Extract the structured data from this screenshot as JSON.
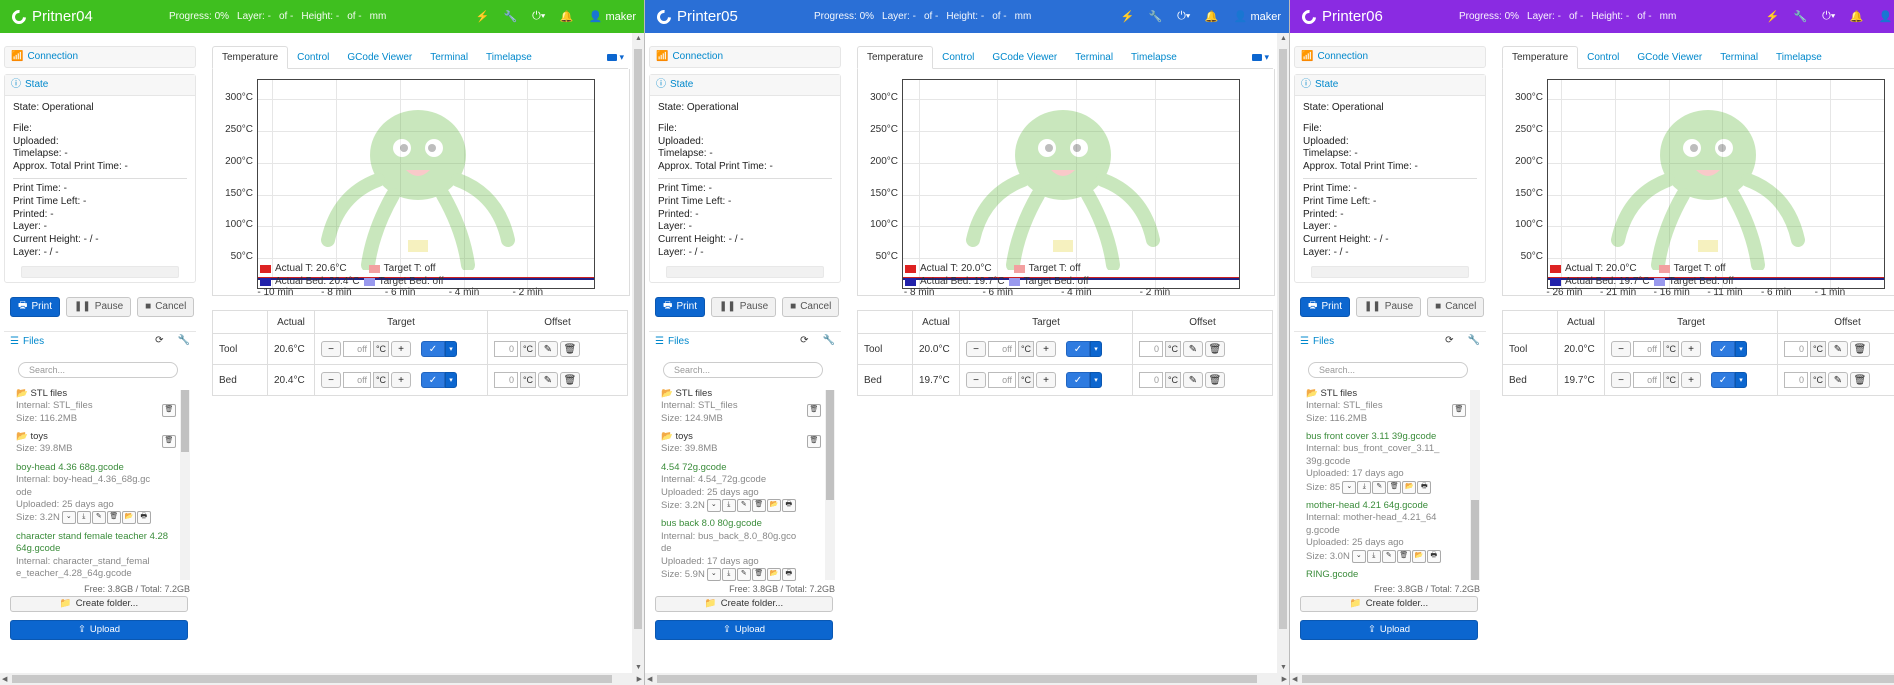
{
  "common": {
    "nav_progress": {
      "progress": "Progress: 0%",
      "layer": "Layer: -",
      "of1": "of -",
      "height": "Height: -",
      "of2": "of -",
      "mm": "mm"
    },
    "user_label": "maker",
    "sidebar": {
      "connection": "Connection",
      "state_title": "State",
      "state_line": "State: Operational",
      "file": "File:",
      "uploaded": "Uploaded:",
      "timelapse": "Timelapse: -",
      "approx": "Approx. Total Print Time: -",
      "print_time": "Print Time: -",
      "print_time_left": "Print Time Left: -",
      "printed": "Printed: -",
      "layer": "Layer: -",
      "current_height": "Current Height: - / -",
      "layer2": "Layer: - / -",
      "print_btn": "Print",
      "pause_btn": "Pause",
      "cancel_btn": "Cancel",
      "files": "Files",
      "search_placeholder": "Search...",
      "free": "Free: 3.8GB / Total: 7.2GB",
      "create_folder": "Create folder...",
      "upload": "Upload"
    },
    "tabs": [
      "Temperature",
      "Control",
      "GCode Viewer",
      "Terminal",
      "Timelapse"
    ],
    "table": {
      "headers": [
        "",
        "Actual",
        "Target",
        "Offset"
      ],
      "tool": "Tool",
      "bed": "Bed",
      "off_placeholder": "off",
      "unit": "°C",
      "zero": "0"
    },
    "y_ticks": [
      "300°C",
      "250°C",
      "200°C",
      "150°C",
      "100°C",
      "50°C"
    ]
  },
  "printers": [
    {
      "name": "Pritner04",
      "color": "#3fbf1f",
      "legend": {
        "actual_t": "Actual T: 20.6°C",
        "target_t": "Target T: off",
        "actual_bed": "Actual Bed: 20.4°C",
        "target_bed": "Target Bed: off"
      },
      "x_ticks": [
        "- 10 min",
        "- 8 min",
        "- 6 min",
        "- 4 min",
        "- 2 min"
      ],
      "tool_actual": "20.6°C",
      "bed_actual": "20.4°C",
      "files": [
        {
          "type": "folder",
          "name": "STL files",
          "lines": [
            "Internal: STL_files",
            "Size: 116.2MB"
          ]
        },
        {
          "type": "folder",
          "name": "toys",
          "lines": [
            "Size: 39.8MB"
          ]
        },
        {
          "type": "file",
          "name": "boy-head 4.36 68g.gcode",
          "lines": [
            "Internal: boy-head_4.36_68g.gc",
            "ode",
            "Uploaded: 25 days ago",
            "Size: 3.2N"
          ]
        },
        {
          "type": "file",
          "name": "character stand female teacher 4.28 64g.gcode",
          "lines": [
            "Internal: character_stand_femal",
            "e_teacher_4.28_64g.gcode"
          ]
        }
      ],
      "scroll_thumb": {
        "top": 0,
        "height": 62
      }
    },
    {
      "name": "Printer05",
      "color": "#2a6fd6",
      "legend": {
        "actual_t": "Actual T: 20.0°C",
        "target_t": "Target T: off",
        "actual_bed": "Actual Bed: 19.7°C",
        "target_bed": "Target Bed: off"
      },
      "x_ticks": [
        "- 8 min",
        "- 6 min",
        "- 4 min",
        "- 2 min"
      ],
      "tool_actual": "20.0°C",
      "bed_actual": "19.7°C",
      "files": [
        {
          "type": "folder",
          "name": "STL files",
          "lines": [
            "Internal: STL_files",
            "Size: 124.9MB"
          ]
        },
        {
          "type": "folder",
          "name": "toys",
          "lines": [
            "Size: 39.8MB"
          ]
        },
        {
          "type": "file",
          "name": "4.54 72g.gcode",
          "lines": [
            "Internal: 4.54_72g.gcode",
            "Uploaded: 25 days ago",
            "Size: 3.2N"
          ]
        },
        {
          "type": "file",
          "name": "bus back 8.0 80g.gcode",
          "lines": [
            "Internal: bus_back_8.0_80g.gco",
            "de",
            "Uploaded: 17 days ago",
            "Size: 5.9N"
          ]
        }
      ],
      "scroll_thumb": {
        "top": 0,
        "height": 110
      }
    },
    {
      "name": "Printer06",
      "color": "#8a2be2",
      "legend": {
        "actual_t": "Actual T: 20.0°C",
        "target_t": "Target T: off",
        "actual_bed": "Actual Bed: 19.7°C",
        "target_bed": "Target Bed: off"
      },
      "x_ticks": [
        "- 26 min",
        "- 21 min",
        "- 16 min",
        "- 11 min",
        "- 6 min",
        "- 1 min"
      ],
      "tool_actual": "20.0°C",
      "bed_actual": "19.7°C",
      "files": [
        {
          "type": "folder",
          "name": "STL files",
          "lines": [
            "Internal: STL_files",
            "Size: 116.2MB"
          ]
        },
        {
          "type": "file",
          "name": "bus front cover 3.11 39g.gcode",
          "lines": [
            "Internal: bus_front_cover_3.11_",
            "39g.gcode",
            "Uploaded: 17 days ago",
            "Size: 85"
          ]
        },
        {
          "type": "file",
          "name": "mother-head 4.21 64g.gcode",
          "lines": [
            "Internal: mother-head_4.21_64",
            "g.gcode",
            "Uploaded: 25 days ago",
            "Size: 3.0N"
          ]
        },
        {
          "type": "file",
          "name": "RING.gcode",
          "lines": []
        }
      ],
      "scroll_thumb": {
        "top": 110,
        "height": 80
      }
    }
  ]
}
